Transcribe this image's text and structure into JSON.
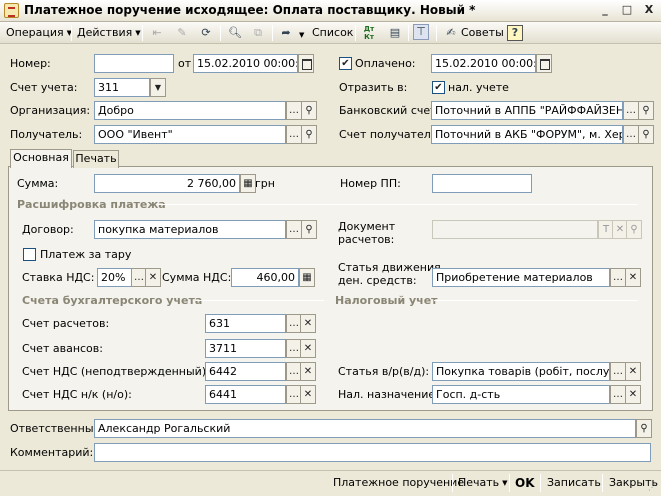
{
  "window": {
    "title": "Платежное поручение исходящее: Оплата поставщику. Новый *",
    "minimize": "_",
    "maximize": "□",
    "close": "X"
  },
  "toolbar": {
    "operation": "Операция",
    "actions": "Действия",
    "list": "Список",
    "advice": "Советы",
    "help": "?",
    "dt_kt": "Дт Кт"
  },
  "header": {
    "number_label": "Номер:",
    "number_value": "",
    "from_label": "от",
    "date_value": "15.02.2010 00:00:00",
    "paid_label": "Оплачено:",
    "paid_checked": true,
    "paid_date": "15.02.2010 00:00:00",
    "account_label": "Счет учета:",
    "account_value": "311",
    "reflect_label": "Отразить в:",
    "tax_label": "нал. учете",
    "tax_checked": true,
    "org_label": "Организация:",
    "org_value": "Добро",
    "bank_label": "Банковский счет:",
    "bank_value": "Поточний в АППБ \"РАЙФФАЙЗЕН Е",
    "recipient_label": "Получатель:",
    "recipient_value": "ООО \"Ивент\"",
    "recipient_account_label": "Счет получателя:",
    "recipient_account_value": "Поточний в АКБ \"ФОРУМ\", м. Херсо"
  },
  "tabs": [
    {
      "label": "Основная"
    },
    {
      "label": "Печать"
    }
  ],
  "main": {
    "sum_label": "Сумма:",
    "sum_value": "2 760,00",
    "currency": "грн",
    "pp_number_label": "Номер ПП:",
    "pp_number_value": "",
    "decode_title": "Расшифровка платежа",
    "contract_label": "Договор:",
    "contract_value": "покупка материалов",
    "doc_label_1": "Документ",
    "doc_label_2": "расчетов:",
    "doc_value": "",
    "tare_label": "Платеж за тару",
    "tare_checked": false,
    "vat_rate_label": "Ставка НДС:",
    "vat_rate_value": "20%",
    "vat_sum_label": "Сумма НДС:",
    "vat_sum_value": "460,00",
    "cashflow_label_1": "Статья движения",
    "cashflow_label_2": "ден. средств:",
    "cashflow_value": "Приобретение материалов",
    "accounts_title": "Счета бухгалтерского учета",
    "tax_title": "Налоговый учет",
    "acc_settle_label": "Счет расчетов:",
    "acc_settle_value": "631",
    "acc_adv_label": "Счет авансов:",
    "acc_adv_value": "3711",
    "acc_vat_label": "Счет НДС (неподтвержденный):",
    "acc_vat_value": "6442",
    "acc_vat_nk_label": "Счет НДС н/к (н/о):",
    "acc_vat_nk_value": "6441",
    "article_label": "Статья в/р(в/д):",
    "article_value": "Покупка товарів (робіт, послуг)",
    "purpose_label": "Нал. назначение:",
    "purpose_value": "Госп. д-сть"
  },
  "footer_fields": {
    "responsible_label": "Ответственный:",
    "responsible_value": "Александр Рогальский",
    "comment_label": "Комментарий:",
    "comment_value": ""
  },
  "bottom": {
    "payment_order": "Платежное поручение",
    "print": "Печать",
    "ok": "OK",
    "save": "Записать",
    "close": "Закрыть"
  },
  "colors": {
    "window_bg": "#ece9d8",
    "panel_bg": "#f4f3ee",
    "field_border": "#7f9db9",
    "section_title": "#8a8675"
  }
}
